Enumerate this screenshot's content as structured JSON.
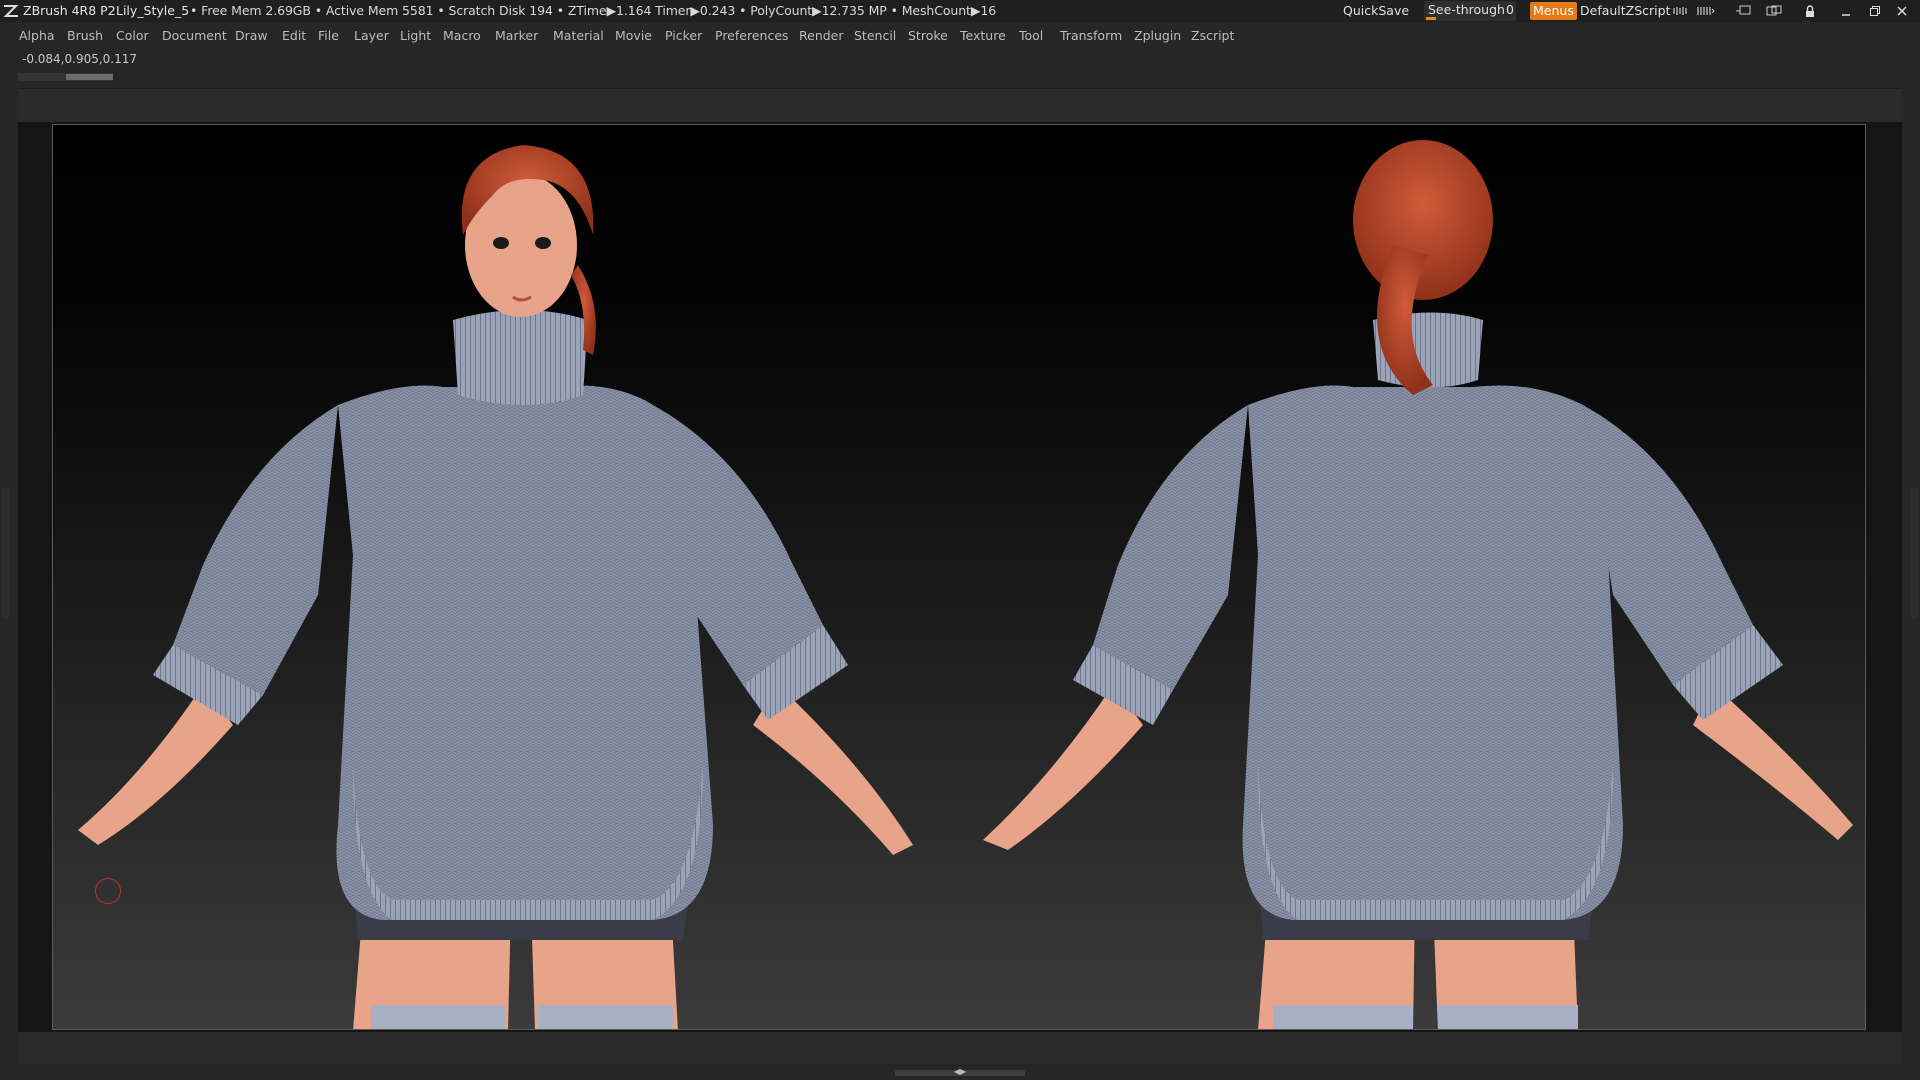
{
  "titlebar": {
    "app_name": "ZBrush 4R8 P2",
    "file_name": "Lily_Style_5",
    "stats": "• Free Mem 2.69GB • Active Mem 5581 • Scratch Disk 194 •  ZTime▶1.164 Timer▶0.243 • PolyCount▶12.735 MP  • MeshCount▶16",
    "quicksave_label": "QuickSave",
    "seethrough_label": "See-through",
    "seethrough_value": "0",
    "menus_label": "Menus",
    "script_name": "DefaultZScript"
  },
  "menubar": {
    "items": [
      "Alpha",
      "Brush",
      "Color",
      "Document",
      "Draw",
      "Edit",
      "File",
      "Layer",
      "Light",
      "Macro",
      "Marker",
      "Material",
      "Movie",
      "Picker",
      "Preferences",
      "Render",
      "Stencil",
      "Stroke",
      "Texture",
      "Tool",
      "Transform",
      "Zplugin",
      "Zscript"
    ]
  },
  "status": {
    "coordinates": "-0.084,0.905,0.117"
  },
  "viewport": {
    "subject": "two views of a 3D character model",
    "colors": {
      "sweater": "#8b93a8",
      "skin": "#e7a489",
      "hair": "#b9472a",
      "shorts": "#3a3c48",
      "accent": "#e37b16"
    }
  }
}
